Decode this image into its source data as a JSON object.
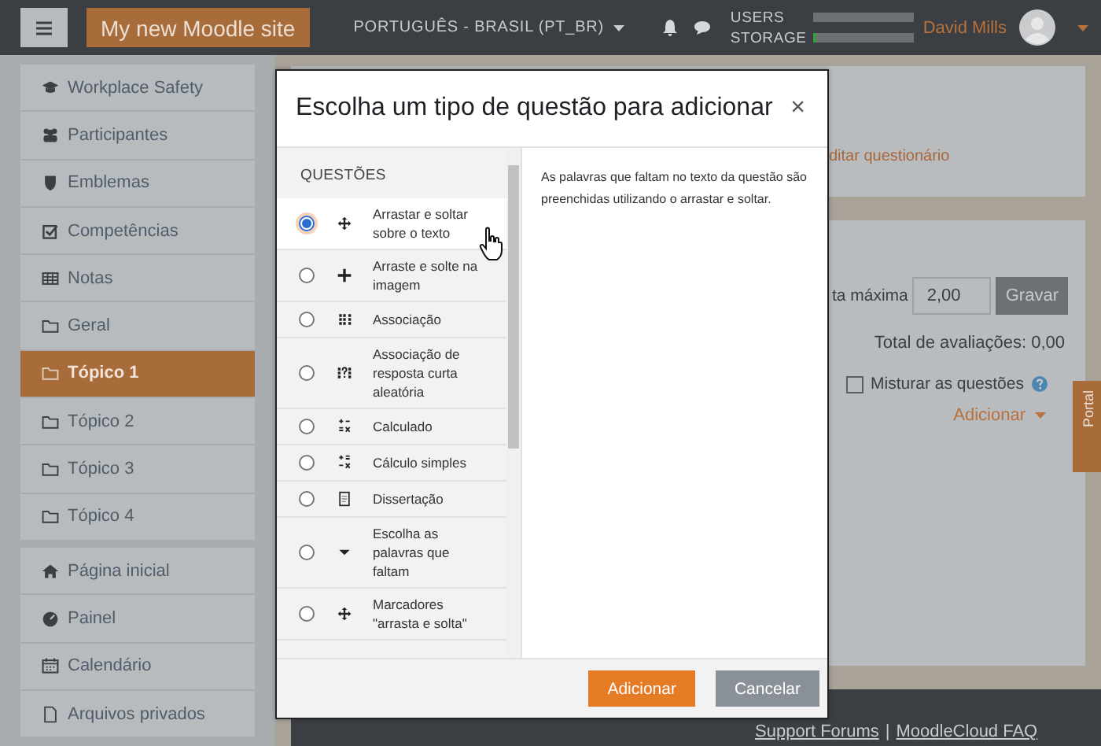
{
  "navbar": {
    "site_name": "My new Moodle site",
    "language": "PORTUGUÊS - BRASIL (PT_BR)",
    "meters": [
      {
        "label": "USERS",
        "level": 0
      },
      {
        "label": "STORAGE",
        "level": 0.04
      }
    ],
    "user": "David Mills"
  },
  "sidebar": {
    "groups": [
      [
        {
          "label": "Workplace Safety",
          "selected": false
        },
        {
          "label": "Participantes",
          "selected": false
        },
        {
          "label": "Emblemas",
          "selected": false
        },
        {
          "label": "Competências",
          "selected": false
        },
        {
          "label": "Notas",
          "selected": false
        },
        {
          "label": "Geral",
          "selected": false
        },
        {
          "label": "Tópico 1",
          "selected": true
        },
        {
          "label": "Tópico 2",
          "selected": false
        },
        {
          "label": "Tópico 3",
          "selected": false
        },
        {
          "label": "Tópico 4",
          "selected": false
        }
      ],
      [
        {
          "label": "Página inicial",
          "selected": false
        },
        {
          "label": "Painel",
          "selected": false
        },
        {
          "label": "Calendário",
          "selected": false
        },
        {
          "label": "Arquivos privados",
          "selected": false
        }
      ]
    ]
  },
  "content": {
    "edit_link": "ditar questionário",
    "grade_label": "ta máxima",
    "grade_value": "2,00",
    "save_button": "Gravar",
    "total": "Total de avaliações: 0,00",
    "shuffle": {
      "label": "Misturar as questões",
      "checked": false
    },
    "add_menu": "Adicionar"
  },
  "portal_tab": "Portal",
  "footer": {
    "links": [
      "Support Forums",
      "MoodleCloud FAQ"
    ],
    "separator": "|"
  },
  "modal": {
    "title": "Escolha um tipo de questão para adicionar",
    "close": "×",
    "section": "QUESTÕES",
    "options": [
      {
        "label": "Arrastar e soltar sobre o texto",
        "selected": true
      },
      {
        "label": "Arraste e solte na imagem",
        "selected": false
      },
      {
        "label": "Associação",
        "selected": false
      },
      {
        "label": "Associação de resposta curta aleatória",
        "selected": false
      },
      {
        "label": "Calculado",
        "selected": false
      },
      {
        "label": "Cálculo simples",
        "selected": false
      },
      {
        "label": "Dissertação",
        "selected": false
      },
      {
        "label": "Escolha as palavras que faltam",
        "selected": false
      },
      {
        "label": "Marcadores \"arrasta e solta\"",
        "selected": false
      }
    ],
    "description": "As palavras que faltam no texto da questão são preenchidas utilizando o arrastar e soltar.",
    "buttons": [
      {
        "label": "Adicionar",
        "kind": "primary"
      },
      {
        "label": "Cancelar",
        "kind": "secondary"
      }
    ]
  }
}
